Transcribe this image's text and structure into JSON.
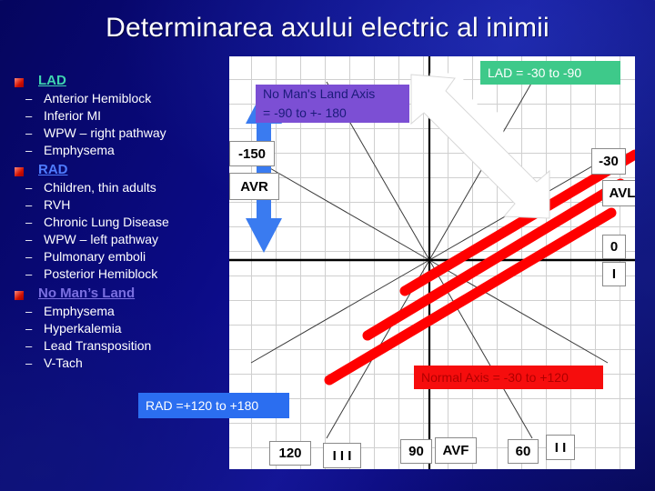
{
  "slide": {
    "title": "Determinarea axului electric al inimii",
    "background_color": "#0b0b86"
  },
  "bullets": [
    {
      "heading": "LAD",
      "heading_color": "#3fd6b0",
      "items": [
        "Anterior Hemiblock",
        "Inferior MI",
        "WPW – right pathway",
        "Emphysema"
      ]
    },
    {
      "heading": "RAD",
      "heading_color": "#4f7cff",
      "items": [
        "Children, thin adults",
        "RVH",
        "Chronic Lung Disease",
        "WPW – left pathway",
        "Pulmonary emboli",
        "Posterior Hemiblock"
      ]
    },
    {
      "heading": "No Man’s Land",
      "heading_color": "#7a6fe0",
      "items": [
        "Emphysema",
        "Hyperkalemia",
        "Lead Transposition",
        "V-Tach"
      ]
    }
  ],
  "dash": "–",
  "chart": {
    "axis_labels": [
      {
        "name": "minus-150",
        "text": "-150"
      },
      {
        "name": "avr",
        "text": "AVR"
      },
      {
        "name": "minus-30",
        "text": "-30"
      },
      {
        "name": "avl",
        "text": "AVL"
      },
      {
        "name": "zero",
        "text": "0"
      },
      {
        "name": "lead-one",
        "text": "I"
      },
      {
        "name": "one-twenty",
        "text": "120"
      },
      {
        "name": "lead-three",
        "text": "I I I"
      },
      {
        "name": "ninety",
        "text": "90"
      },
      {
        "name": "avf",
        "text": "AVF"
      },
      {
        "name": "sixty",
        "text": "60"
      },
      {
        "name": "lead-two",
        "text": "I I"
      }
    ],
    "callouts": {
      "no_mans_land": {
        "line1": "No Man's Land Axis",
        "line2": "= -90 to +- 180",
        "bg": "#7c4fd4",
        "fg": "#1b1b7a"
      },
      "lad": {
        "text": "LAD = -30 to -90",
        "bg": "#3ec98a",
        "fg": "#ffffff"
      },
      "normal": {
        "text": "Normal Axis = -30 to +120",
        "bg": "#f60d0d",
        "fg": "#b00000"
      },
      "rad": {
        "text": "RAD =+120 to +180",
        "bg": "#2b6ef0",
        "fg": "#ffffff"
      }
    },
    "markers": {
      "white_arrow": "white-down-right-arrow",
      "blue_arrow": "blue-double-headed-vertical-arrow",
      "red_band": "red-triple-diagonal-band"
    }
  }
}
